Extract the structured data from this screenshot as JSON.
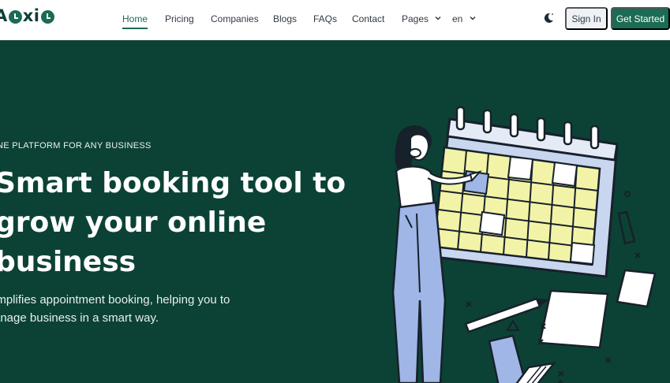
{
  "brand": {
    "logo_text": "Aoxio"
  },
  "nav": {
    "items": [
      {
        "label": "Home",
        "active": true
      },
      {
        "label": "Pricing"
      },
      {
        "label": "Companies"
      },
      {
        "label": "Blogs"
      },
      {
        "label": "FAQs"
      },
      {
        "label": "Contact"
      },
      {
        "label": "Pages",
        "dropdown": true
      },
      {
        "label": "en",
        "dropdown": true
      }
    ],
    "theme_icon": "moon-icon",
    "signin_label": "Sign In",
    "cta_label": "Get Started"
  },
  "hero": {
    "tagline": "NE PLATFORM FOR ANY BUSINESS",
    "headline": [
      "Smart booking tool to",
      "grow your online",
      "business"
    ],
    "description": [
      "implifies appointment booking, helping you to",
      "anage business in a smart way."
    ],
    "illustration": "calendar-booking-illustration"
  },
  "colors": {
    "brand": "#1b6b55",
    "hero_bg": "#0c4236",
    "calendar_cell": "#f2f3a6",
    "calendar_frame": "#c9d6ef",
    "pants": "#9fb6e6"
  }
}
